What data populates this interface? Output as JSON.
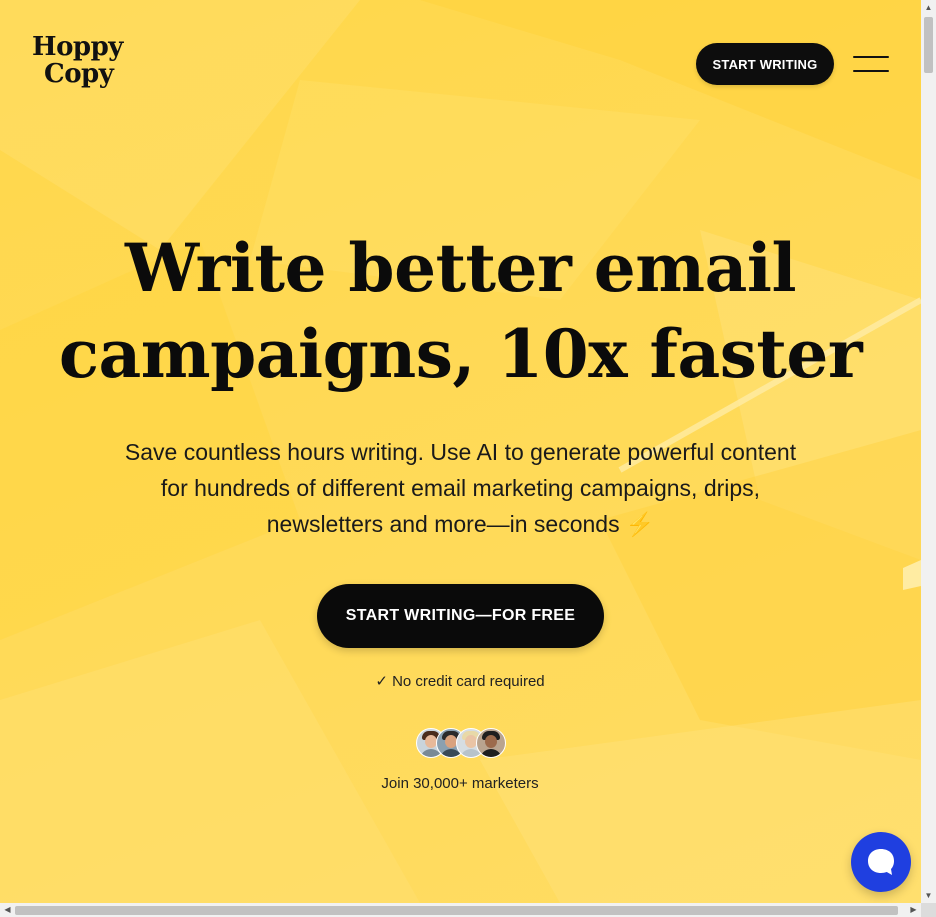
{
  "header": {
    "logo_line1": "Hoppy",
    "logo_line2": "Copy",
    "cta_label": "START WRITING",
    "menu_icon": "hamburger-icon"
  },
  "hero": {
    "headline_line1": "Write better email",
    "headline_line2": "campaigns, 10x faster",
    "subcopy_line1": "Save countless hours writing. Use AI to generate powerful content",
    "subcopy_line2": "for hundreds of different email marketing campaigns, drips,",
    "subcopy_line3": "newsletters and more—in seconds",
    "subcopy_emoji": "⚡",
    "cta_label": "START WRITING—FOR FREE",
    "note": "✓ No credit card required",
    "avatar_count": 4,
    "join_text": "Join 30,000+ marketers"
  },
  "chat": {
    "icon": "chat-bubble-icon"
  },
  "colors": {
    "background": "#ffd84a",
    "button": "#0a0a0a",
    "button_text": "#ffffff",
    "chat": "#1f3fe0"
  }
}
